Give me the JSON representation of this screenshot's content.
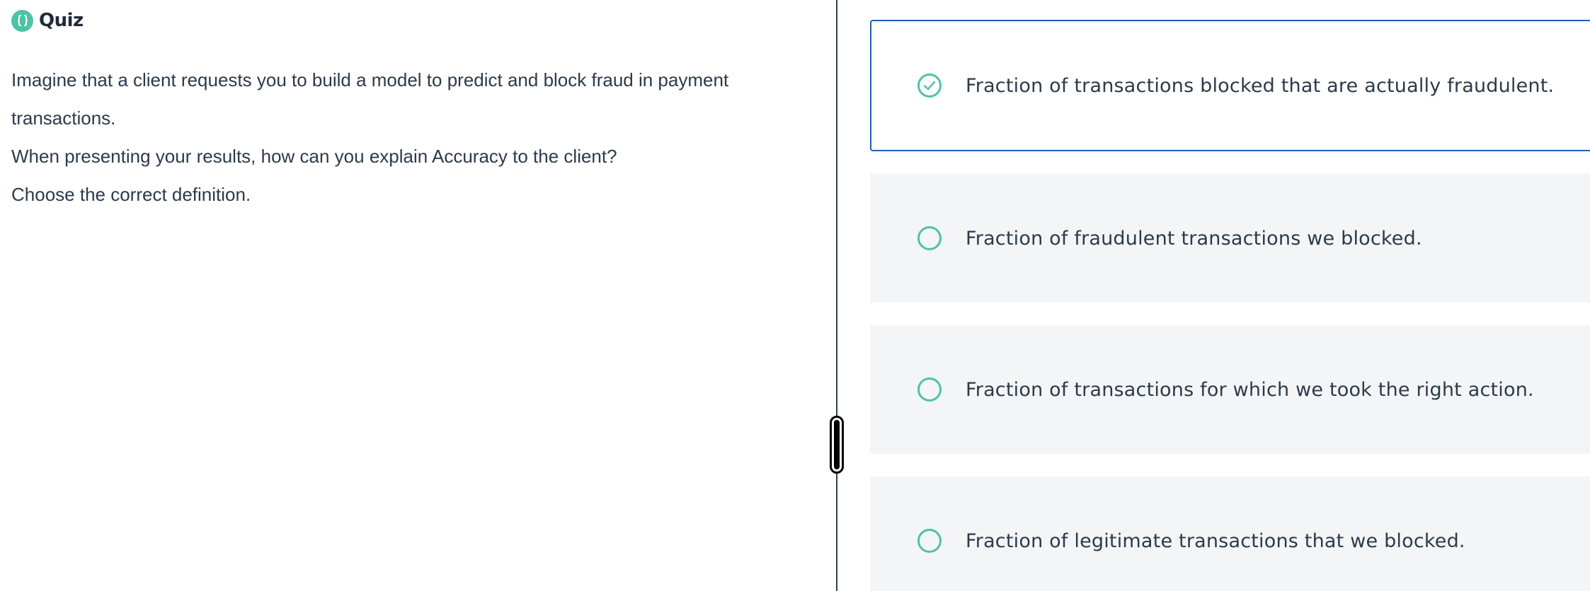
{
  "header": {
    "title": "Quiz",
    "icon": "code-braces-icon",
    "accent_color": "#4ec2a6"
  },
  "question": {
    "line1": "Imagine that a client requests you to build a model to predict and block fraud in payment transactions.",
    "line2": "When presenting your results, how can you explain Accuracy to the client?",
    "line3": "Choose the correct definition."
  },
  "options": [
    {
      "label": "Fraction of transactions blocked that are actually fraudulent.",
      "selected": true
    },
    {
      "label": "Fraction of fraudulent transactions we blocked.",
      "selected": false
    },
    {
      "label": "Fraction of transactions for which we took the right action.",
      "selected": false
    },
    {
      "label": "Fraction of legitimate transactions that we blocked.",
      "selected": false
    }
  ],
  "colors": {
    "selected_border": "#1d5eb8",
    "option_background": "#f4f5f7",
    "radio": "#4ec2a6"
  }
}
